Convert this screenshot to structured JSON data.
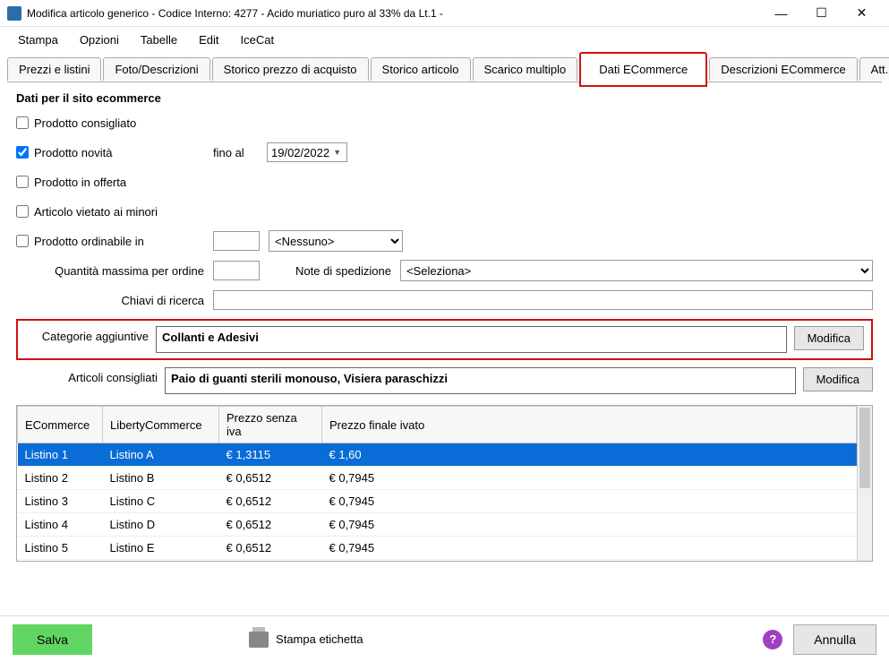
{
  "window": {
    "title": "Modifica articolo generico - Codice Interno: 4277 - Acido muriatico puro al 33% da Lt.1 -"
  },
  "menu": [
    "Stampa",
    "Opzioni",
    "Tabelle",
    "Edit",
    "IceCat"
  ],
  "tabs": {
    "items": [
      "Prezzi e listini",
      "Foto/Descrizioni",
      "Storico prezzo di acquisto",
      "Storico articolo",
      "Scarico multiplo",
      "Dati ECommerce",
      "Descrizioni ECommerce",
      "Att..."
    ],
    "active": "Dati ECommerce"
  },
  "section_title": "Dati per il sito ecommerce",
  "checks": {
    "consigliato": "Prodotto consigliato",
    "novita": "Prodotto novità",
    "offerta": "Prodotto in offerta",
    "vietato": "Articolo vietato ai minori",
    "ordinabile": "Prodotto ordinabile in"
  },
  "labels": {
    "fino_al": "fino al",
    "qta_max": "Quantità massima per ordine",
    "note_sped": "Note di spedizione",
    "chiavi": "Chiavi di ricerca",
    "categorie": "Categorie aggiuntive",
    "articoli_cons": "Articoli consigliati"
  },
  "values": {
    "date_novita": "19/02/2022",
    "ordinabile_select": "<Nessuno>",
    "note_sped_select": "<Seleziona>",
    "categorie": "Collanti e Adesivi",
    "articoli_cons": "Paio di guanti sterili monouso, Visiera paraschizzi"
  },
  "buttons": {
    "modifica": "Modifica",
    "salva": "Salva",
    "annulla": "Annulla",
    "stampa_etichetta": "Stampa etichetta"
  },
  "grid": {
    "headers": [
      "ECommerce",
      "LibertyCommerce",
      "Prezzo senza iva",
      "Prezzo finale ivato"
    ],
    "rows": [
      {
        "c0": "Listino 1",
        "c1": "Listino A",
        "c2": "€ 1,3115",
        "c3": "€ 1,60"
      },
      {
        "c0": "Listino 2",
        "c1": "Listino B",
        "c2": "€ 0,6512",
        "c3": "€ 0,7945"
      },
      {
        "c0": "Listino 3",
        "c1": "Listino C",
        "c2": "€ 0,6512",
        "c3": "€ 0,7945"
      },
      {
        "c0": "Listino 4",
        "c1": "Listino D",
        "c2": "€ 0,6512",
        "c3": "€ 0,7945"
      },
      {
        "c0": "Listino 5",
        "c1": "Listino E",
        "c2": "€ 0,6512",
        "c3": "€ 0,7945"
      }
    ]
  }
}
